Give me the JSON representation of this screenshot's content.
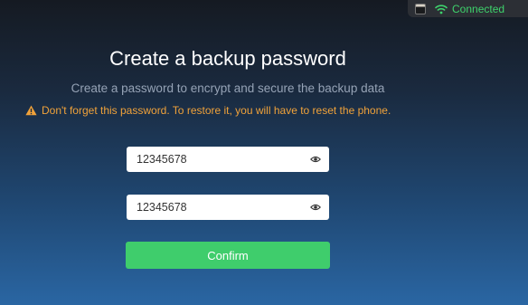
{
  "status": {
    "device_icon": "phone-icon",
    "wifi_icon": "wifi-icon",
    "connection": "Connected",
    "connection_color": "#3ed26c"
  },
  "dialog": {
    "title": "Create a backup password",
    "subtitle": "Create a password to encrypt and secure the backup data",
    "warning_icon": "warning-icon",
    "warning": "Don't forget this password. To restore it, you will have to reset the phone.",
    "warning_color": "#f0a23a"
  },
  "form": {
    "password": {
      "value": "12345678",
      "icon": "eye-icon"
    },
    "confirm_password": {
      "value": "12345678",
      "icon": "eye-icon"
    },
    "confirm_label": "Confirm",
    "confirm_color": "#3fcd6c"
  }
}
